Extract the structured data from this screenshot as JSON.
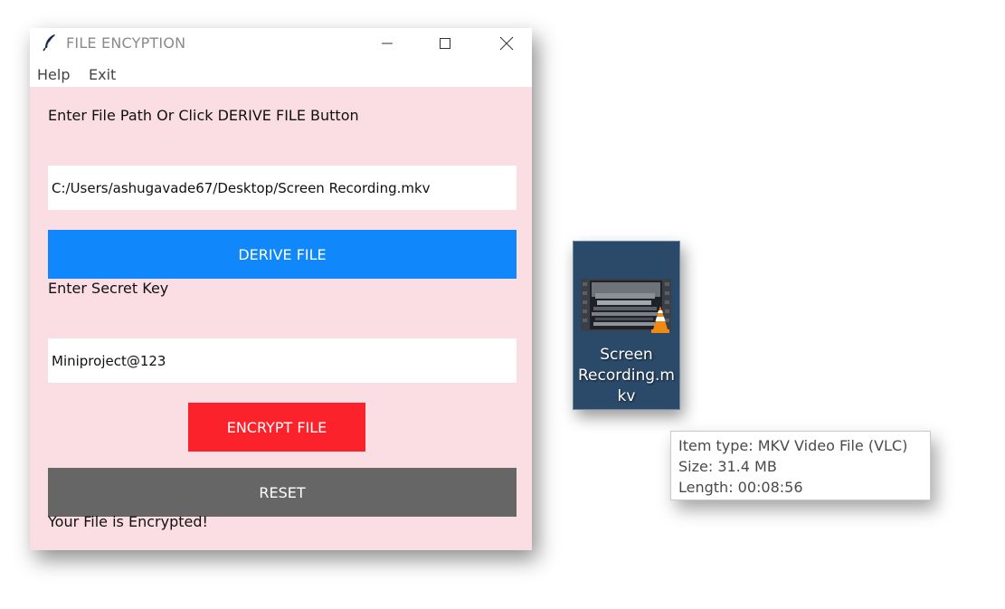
{
  "window": {
    "title": "FILE ENCYPTION",
    "menu": {
      "help": "Help",
      "exit": "Exit"
    }
  },
  "form": {
    "path_label": "Enter File Path Or Click DERIVE FILE Button",
    "path_value": "C:/Users/ashugavade67/Desktop/Screen Recording.mkv",
    "derive_button": "DERIVE FILE",
    "key_label": "Enter Secret Key",
    "key_value": "Miniproject@123",
    "encrypt_button": "ENCRYPT FILE",
    "reset_button": "RESET",
    "status": "Your File is Encrypted!"
  },
  "desktop_file": {
    "name_line1": "Screen",
    "name_line2": "Recording.m",
    "name_line3": "kv",
    "icon": "vlc-video-file-icon"
  },
  "tooltip": {
    "type": "Item type: MKV Video File (VLC)",
    "size": "Size: 31.4 MB",
    "length": "Length: 00:08:56"
  },
  "colors": {
    "content_bg": "#fbdde4",
    "derive_button": "#1087fb",
    "encrypt_button": "#fb222b",
    "reset_button": "#666666",
    "file_tile": "#2b4a6a"
  }
}
